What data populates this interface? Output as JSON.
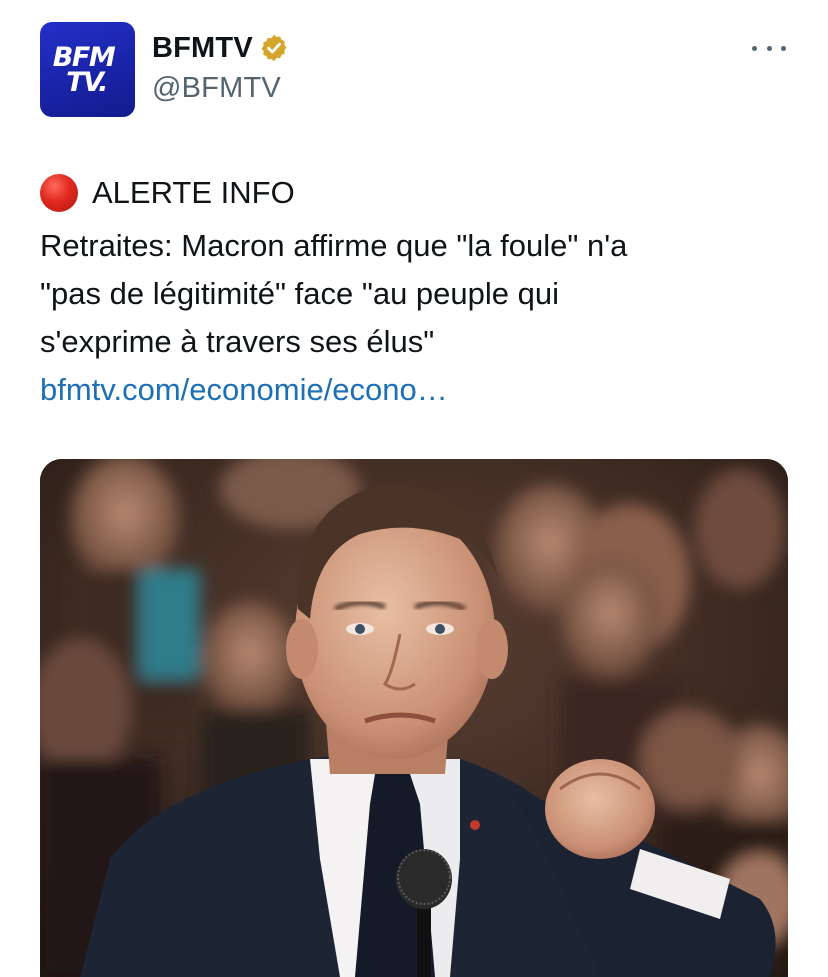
{
  "account": {
    "display_name": "BFMTV",
    "handle": "@BFMTV",
    "verified": true,
    "avatar": {
      "line1": "BFM",
      "line2": "TV.",
      "color": "#1a23a8"
    },
    "verified_color": "#d4a72c"
  },
  "menu": {
    "icon": "more-horizontal-icon"
  },
  "tweet": {
    "alert_emoji": "red-circle-icon",
    "alert_label": "ALERTE INFO",
    "lines": [
      "Retraites: Macron affirme que \"la foule\" n'a",
      "\"pas de légitimité\" face \"au peuple qui",
      "s'exprime à travers ses élus\""
    ],
    "link_text": "bfmtv.com/economie/econo…",
    "link_color": "#1d6fb6"
  },
  "media": {
    "kind": "photo"
  }
}
